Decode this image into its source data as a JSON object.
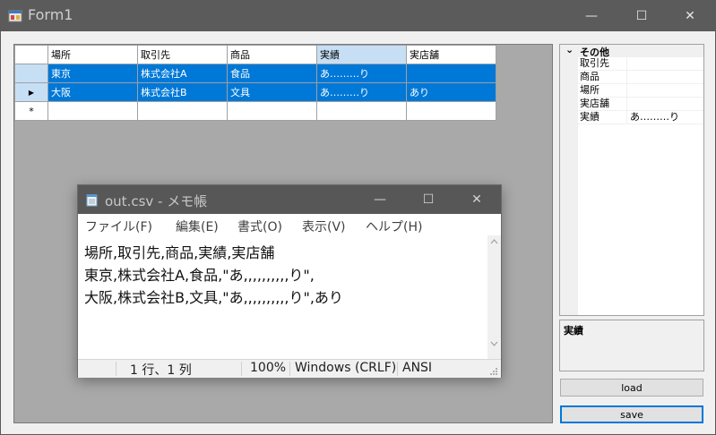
{
  "window": {
    "title": "Form1",
    "minimize": "—",
    "maximize": "☐",
    "close": "✕"
  },
  "grid": {
    "columns": [
      "場所",
      "取引先",
      "商品",
      "実績",
      "実店舗"
    ],
    "rows": [
      [
        "東京",
        "株式会社A",
        "食品",
        "あ………り",
        ""
      ],
      [
        "大阪",
        "株式会社B",
        "文具",
        "あ………り",
        "あり"
      ]
    ],
    "current_row_marker": "▶",
    "new_row_marker": "*"
  },
  "property_grid": {
    "category": "その他",
    "category_toggle": "⌄",
    "items": [
      {
        "name": "取引先",
        "value": ""
      },
      {
        "name": "商品",
        "value": ""
      },
      {
        "name": "場所",
        "value": ""
      },
      {
        "name": "実店舗",
        "value": ""
      },
      {
        "name": "実績",
        "value": "あ………り"
      }
    ],
    "description_title": "実績"
  },
  "buttons": {
    "load": "load",
    "save": "save"
  },
  "notepad": {
    "title": "out.csv - メモ帳",
    "minimize": "—",
    "maximize": "☐",
    "close": "✕",
    "menu": [
      "ファイル(F)",
      "編集(E)",
      "書式(O)",
      "表示(V)",
      "ヘルプ(H)"
    ],
    "lines": [
      "場所,取引先,商品,実績,実店舗",
      "東京,株式会社A,食品,\"あ,,,,,,,,,,り\",",
      "大阪,株式会社B,文具,\"あ,,,,,,,,,,り\",あり"
    ],
    "status": {
      "position": "1 行、1 列",
      "zoom": "100%",
      "eol": "Windows (CRLF)",
      "encoding": "ANSI"
    }
  }
}
